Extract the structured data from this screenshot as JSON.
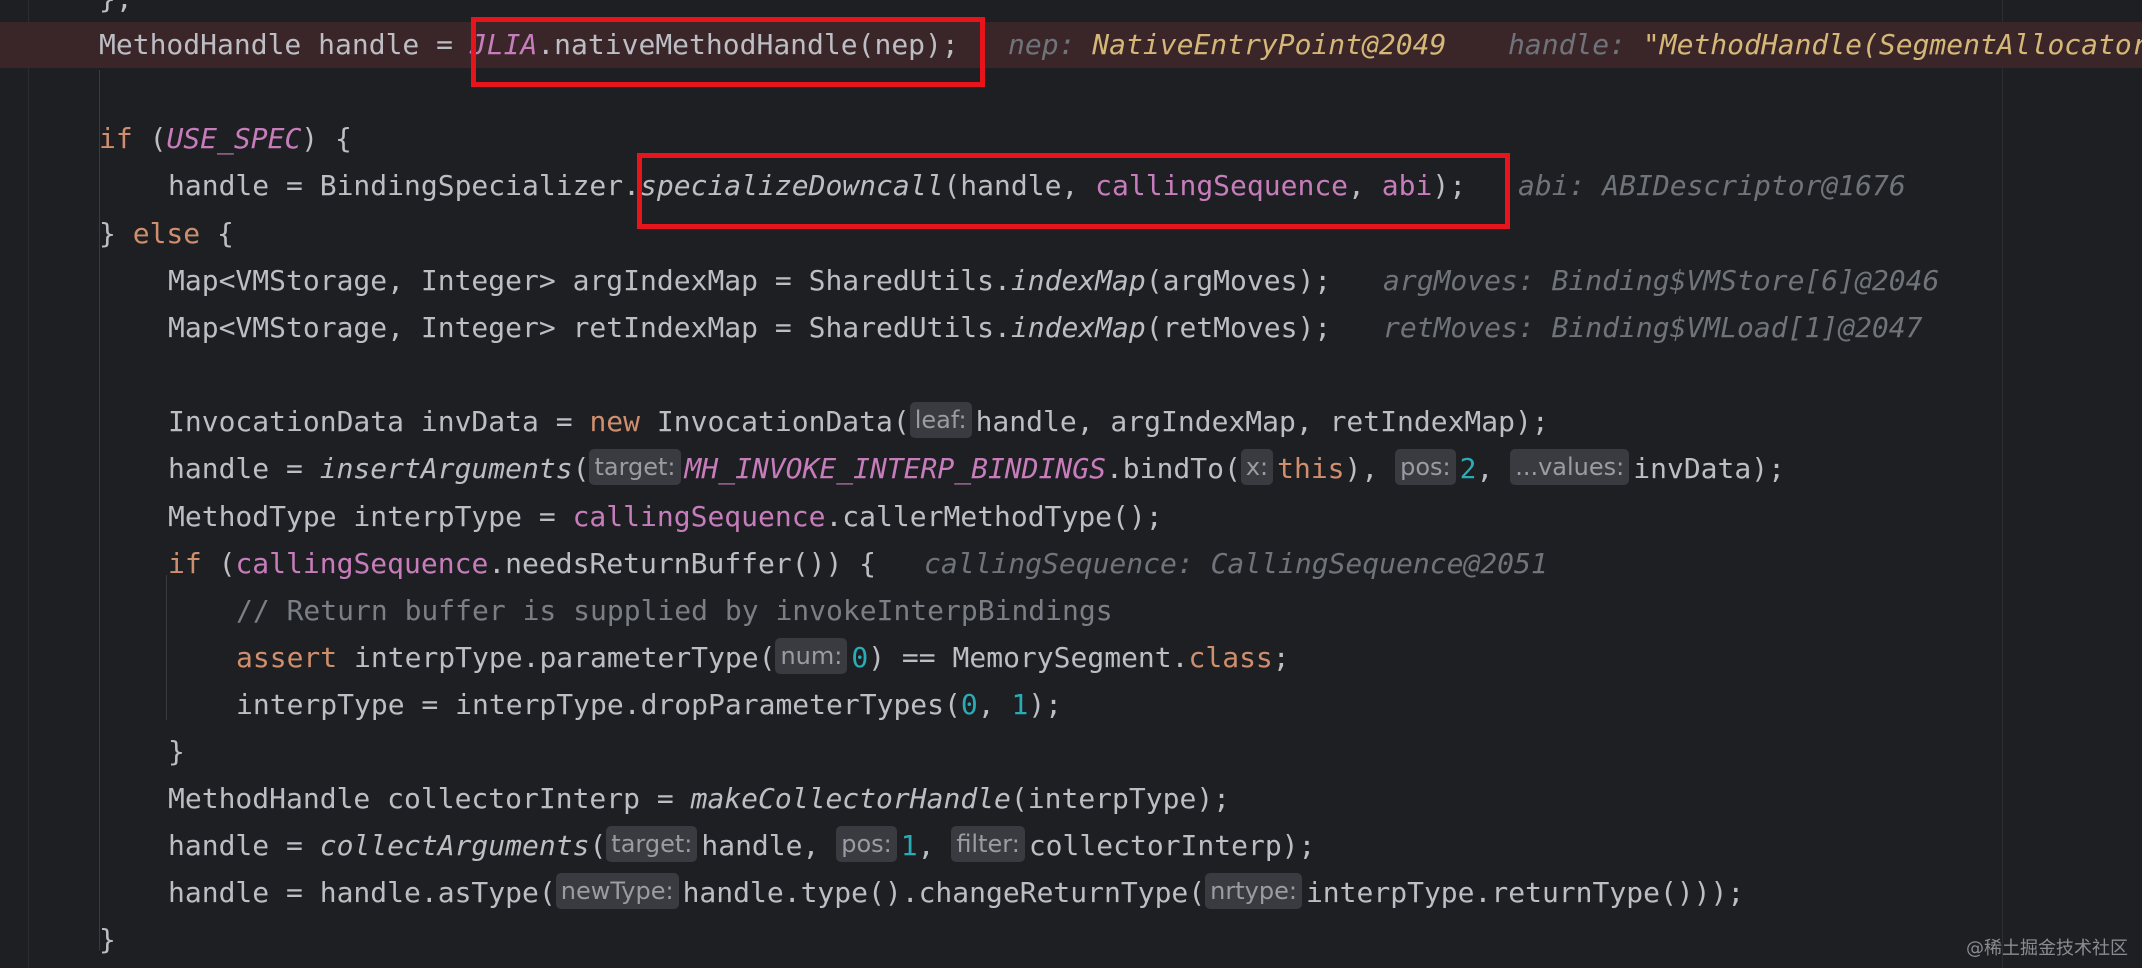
{
  "editor": {
    "top_fragment": "};",
    "line_exec": {
      "code_a": "MethodHandle handle = ",
      "field_a": "JLIA",
      "code_b": ".nativeMethodHandle(nep);",
      "dbg1_name": "nep: ",
      "dbg1_val": "NativeEntryPoint@2049",
      "dbg2_name": "handle: ",
      "dbg2_val": "\"MethodHandle(SegmentAllocator"
    },
    "line_if_spec": {
      "kw_if": "if",
      "paren_open": " (",
      "field": "USE_SPEC",
      "paren_close": ") {"
    },
    "line_specialize": {
      "code_a": "handle = BindingSpecializer.",
      "method": "specializeDowncall",
      "code_b": "(handle, ",
      "field_a": "callingSequence",
      "code_c": ", ",
      "field_b": "abi",
      "code_d": ");",
      "dbg": "abi: ABIDescriptor@1676"
    },
    "line_else": {
      "brace": "} ",
      "kw_else": "else",
      "brace_open": " {"
    },
    "line_argmap": {
      "code_a": "Map<VMStorage, Integer> argIndexMap = SharedUtils.",
      "method": "indexMap",
      "code_b": "(argMoves);",
      "dbg": "argMoves: Binding$VMStore[6]@2046"
    },
    "line_retmap": {
      "code_a": "Map<VMStorage, Integer> retIndexMap = SharedUtils.",
      "method": "indexMap",
      "code_b": "(retMoves);",
      "dbg": "retMoves: Binding$VMLoad[1]@2047"
    },
    "line_invdata": {
      "code_a": "InvocationData invData = ",
      "kw_new": "new",
      "code_b": " InvocationData(",
      "hint_leaf": "leaf:",
      "code_c": "handle, argIndexMap, retIndexMap);"
    },
    "line_insert": {
      "code_a": "handle = ",
      "method": "insertArguments",
      "code_b": "(",
      "hint_target": "target:",
      "field": "MH_INVOKE_INTERP_BINDINGS",
      "code_c": ".bindTo(",
      "hint_x": "x:",
      "kw_this": "this",
      "code_d": "), ",
      "hint_pos": "pos:",
      "num_pos": "2",
      "code_e": ", ",
      "hint_values": "...values:",
      "code_f": "invData);"
    },
    "line_interptype": {
      "code_a": "MethodType interpType = ",
      "field": "callingSequence",
      "code_b": ".callerMethodType();"
    },
    "line_if_needs": {
      "kw_if": "if",
      "code_a": " (",
      "field": "callingSequence",
      "code_b": ".needsReturnBuffer()) {",
      "dbg": "callingSequence: CallingSequence@2051"
    },
    "line_comment": "// Return buffer is supplied by invokeInterpBindings",
    "line_assert": {
      "kw_assert": "assert",
      "code_a": " interpType.parameterType(",
      "hint_num": "num:",
      "num_zero": "0",
      "code_b": ") == MemorySegment.",
      "kw_class": "class",
      "code_c": ";"
    },
    "line_drop": {
      "code_a": "interpType = interpType.dropParameterTypes(",
      "num_a": "0",
      "code_b": ", ",
      "num_b": "1",
      "code_c": ");"
    },
    "line_close_inner": "}",
    "line_collector": {
      "code_a": "MethodHandle collectorInterp = ",
      "method": "makeCollectorHandle",
      "code_b": "(interpType);"
    },
    "line_collect": {
      "code_a": "handle = ",
      "method": "collectArguments",
      "code_b": "(",
      "hint_target": "target:",
      "code_c": "handle, ",
      "hint_pos": "pos:",
      "num_pos": "1",
      "code_d": ", ",
      "hint_filter": "filter:",
      "code_e": "collectorInterp);"
    },
    "line_astype": {
      "code_a": "handle = handle.asType(",
      "hint_newtype": "newType:",
      "code_b": "handle.type().changeReturnType(",
      "hint_nrtype": "nrtype:",
      "code_c": "interpType.returnType()));"
    },
    "line_close_outer": "}"
  },
  "watermark": "@稀土掘金技术社区",
  "colors": {
    "background": "#1e1f22",
    "exec_line": "#3a2629",
    "highlight_box": "#e8141c",
    "keyword": "#cf8e6d",
    "field": "#c77dbb",
    "number": "#2aacb8"
  }
}
